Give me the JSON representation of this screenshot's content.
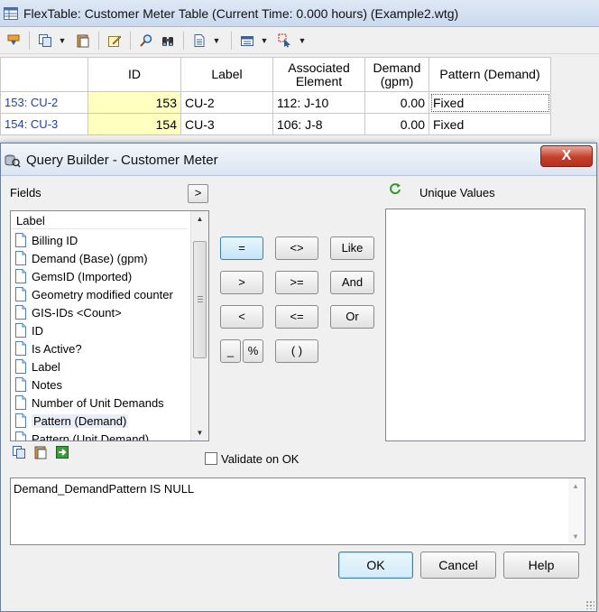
{
  "flextable": {
    "title": "FlexTable: Customer Meter Table (Current Time:  0.000 hours) (Example2.wtg)",
    "toolbar_icons": [
      "zoom-to-icon",
      "copy-icon",
      "paste-icon",
      "edit-icon",
      "find-icon",
      "binoculars-icon",
      "report-icon",
      "options-icon",
      "filter-icon"
    ],
    "columns": [
      "ID",
      "Label",
      "Associated Element",
      "Demand (gpm)",
      "Pattern (Demand)"
    ],
    "rows": [
      {
        "header": "153: CU-2",
        "id": "153",
        "label": "CU-2",
        "element": "112: J-10",
        "demand": "0.00",
        "pattern": "Fixed"
      },
      {
        "header": "154: CU-3",
        "id": "154",
        "label": "CU-3",
        "element": "106: J-8",
        "demand": "0.00",
        "pattern": "Fixed"
      }
    ]
  },
  "dialog": {
    "title": "Query Builder - Customer Meter",
    "close_label": "X",
    "fields_label": "Fields",
    "add_field_label": ">",
    "fields_header": "Label",
    "fields": [
      "Billing ID",
      "Demand (Base) (gpm)",
      "GemsID (Imported)",
      "Geometry modified counter",
      "GIS-IDs <Count>",
      "ID",
      "Is Active?",
      "Label",
      "Notes",
      "Number of Unit Demands",
      "Pattern (Demand)",
      "Pattern (Unit Demand)"
    ],
    "selected_field": "Pattern (Demand)",
    "operators": {
      "eq": "=",
      "neq": "<>",
      "like": "Like",
      "gt": ">",
      "gte": ">=",
      "and": "And",
      "lt": "<",
      "lte": "<=",
      "or": "Or",
      "underscore": "_",
      "percent": "%",
      "parens": "( )"
    },
    "unique_values_label": "Unique Values",
    "validate_label": "Validate on OK",
    "validate_checked": false,
    "query_text": "Demand_DemandPattern IS NULL",
    "buttons": {
      "ok": "OK",
      "cancel": "Cancel",
      "help": "Help"
    }
  }
}
